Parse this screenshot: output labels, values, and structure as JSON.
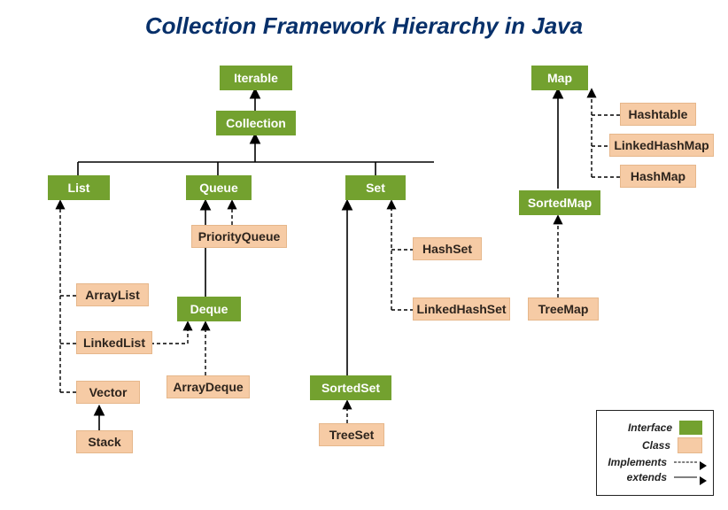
{
  "title": "Collection Framework Hierarchy in Java",
  "interfaces": {
    "iterable": "Iterable",
    "collection": "Collection",
    "list": "List",
    "queue": "Queue",
    "set": "Set",
    "deque": "Deque",
    "sortedset": "SortedSet",
    "map": "Map",
    "sortedmap": "SortedMap"
  },
  "classes": {
    "arraylist": "ArrayList",
    "linkedlist": "LinkedList",
    "vector": "Vector",
    "stack": "Stack",
    "priorityqueue": "PriorityQueue",
    "arraydeque": "ArrayDeque",
    "hashset": "HashSet",
    "linkedhashset": "LinkedHashSet",
    "treeset": "TreeSet",
    "treemap": "TreeMap",
    "hashtable": "Hashtable",
    "linkedhashmap": "LinkedHashMap",
    "hashmap": "HashMap"
  },
  "legend": {
    "interface": "Interface",
    "class": "Class",
    "implements": "Implements",
    "extends": "extends"
  },
  "edges_extends": [
    [
      "collection",
      "iterable"
    ],
    [
      "list",
      "collection"
    ],
    [
      "queue",
      "collection"
    ],
    [
      "set",
      "collection"
    ],
    [
      "deque",
      "queue"
    ],
    [
      "sortedset",
      "set"
    ],
    [
      "sortedmap",
      "map"
    ],
    [
      "stack",
      "vector"
    ]
  ],
  "edges_implements": [
    [
      "arraylist",
      "list"
    ],
    [
      "linkedlist",
      "list"
    ],
    [
      "vector",
      "list"
    ],
    [
      "linkedlist",
      "deque"
    ],
    [
      "priorityqueue",
      "queue"
    ],
    [
      "arraydeque",
      "deque"
    ],
    [
      "hashset",
      "set"
    ],
    [
      "linkedhashset",
      "set"
    ],
    [
      "treeset",
      "sortedset"
    ],
    [
      "hashtable",
      "map"
    ],
    [
      "linkedhashmap",
      "map"
    ],
    [
      "hashmap",
      "map"
    ],
    [
      "treemap",
      "sortedmap"
    ]
  ],
  "colors": {
    "interface": "#73a12f",
    "class": "#f6cba5",
    "title": "#07306a"
  }
}
